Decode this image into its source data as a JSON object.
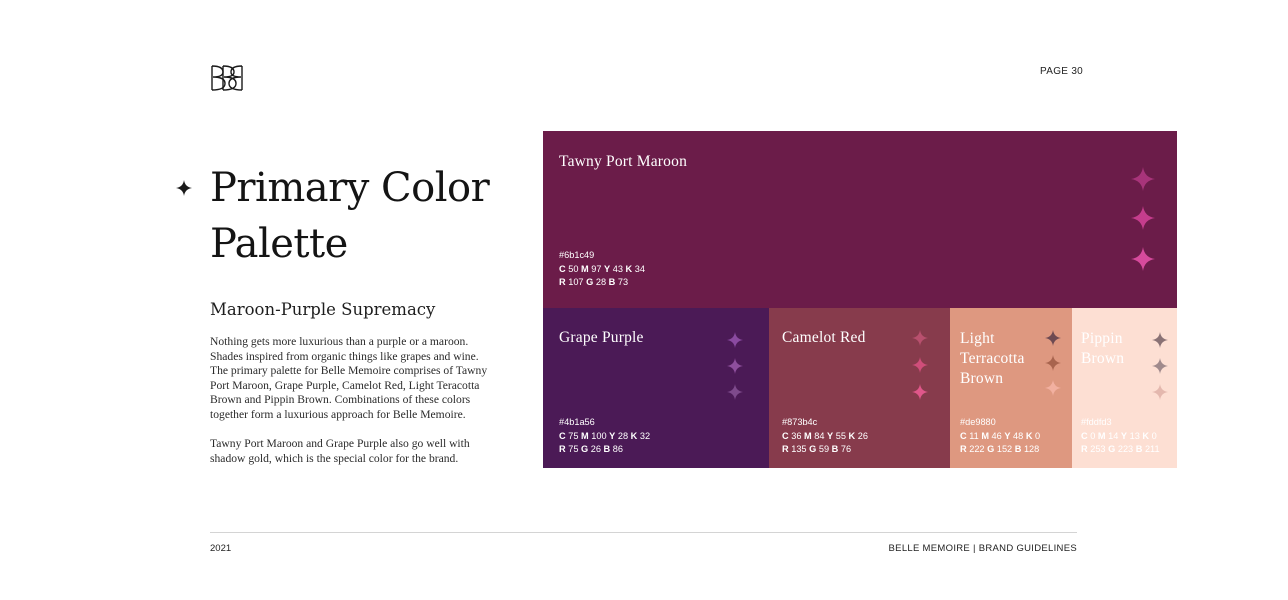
{
  "header": {
    "page_label": "PAGE 30"
  },
  "title": {
    "line1": "Primary Color",
    "line2": "Palette"
  },
  "subtitle": "Maroon-Purple Supremacy",
  "body": {
    "paragraph1": "Nothing gets more luxurious than a purple or a maroon. Shades inspired from organic things like grapes and wine. The primary palette for Belle Memoire comprises of Tawny Port Maroon, Grape Purple, Camelot Red, Light Teracotta Brown and Pippin Brown. Combinations of these colors together form a luxurious approach for Belle Memoire.",
    "paragraph2": "Tawny Port Maroon and Grape Purple also go well with shadow gold, which is the special color for the brand."
  },
  "palette": [
    {
      "name": "Tawny Port Maroon",
      "hex": "#6b1c49",
      "cmyk": {
        "c": "50",
        "m": "97",
        "y": "43",
        "k": "34"
      },
      "rgb": {
        "r": "107",
        "g": "28",
        "b": "73"
      },
      "star_colors": [
        "#a8347a",
        "#c53d8d",
        "#d64a9c"
      ]
    },
    {
      "name": "Grape Purple",
      "hex": "#4b1a56",
      "cmyk": {
        "c": "75",
        "m": "100",
        "y": "28",
        "k": "32"
      },
      "rgb": {
        "r": "75",
        "g": "26",
        "b": "86"
      },
      "star_colors": [
        "#8a4aa0",
        "#8e4f9d",
        "#7e4a8c"
      ]
    },
    {
      "name": "Camelot Red",
      "hex": "#873b4c",
      "cmyk": {
        "c": "36",
        "m": "84",
        "y": "55",
        "k": "26"
      },
      "rgb": {
        "r": "135",
        "g": "59",
        "b": "76"
      },
      "star_colors": [
        "#b8506e",
        "#cf4e7a",
        "#e0578a"
      ]
    },
    {
      "name": "Light Terracotta Brown",
      "hex": "#de9880",
      "cmyk": {
        "c": "11",
        "m": "46",
        "y": "48",
        "k": "0"
      },
      "rgb": {
        "r": "222",
        "g": "152",
        "b": "128"
      },
      "star_colors": [
        "#6e4a52",
        "#a8644e",
        "#f2b0a0"
      ]
    },
    {
      "name": "Pippin Brown",
      "hex": "#fddfd3",
      "cmyk": {
        "c": "0",
        "m": "14",
        "y": "13",
        "k": "0"
      },
      "rgb": {
        "r": "253",
        "g": "223",
        "b": "211"
      },
      "star_colors": [
        "#8a7275",
        "#a08a8c",
        "#e4b8ae"
      ]
    }
  ],
  "footer": {
    "year": "2021",
    "brand": "BELLE MEMOIRE",
    "separator": "|",
    "section": "BRAND GUIDELINES"
  }
}
